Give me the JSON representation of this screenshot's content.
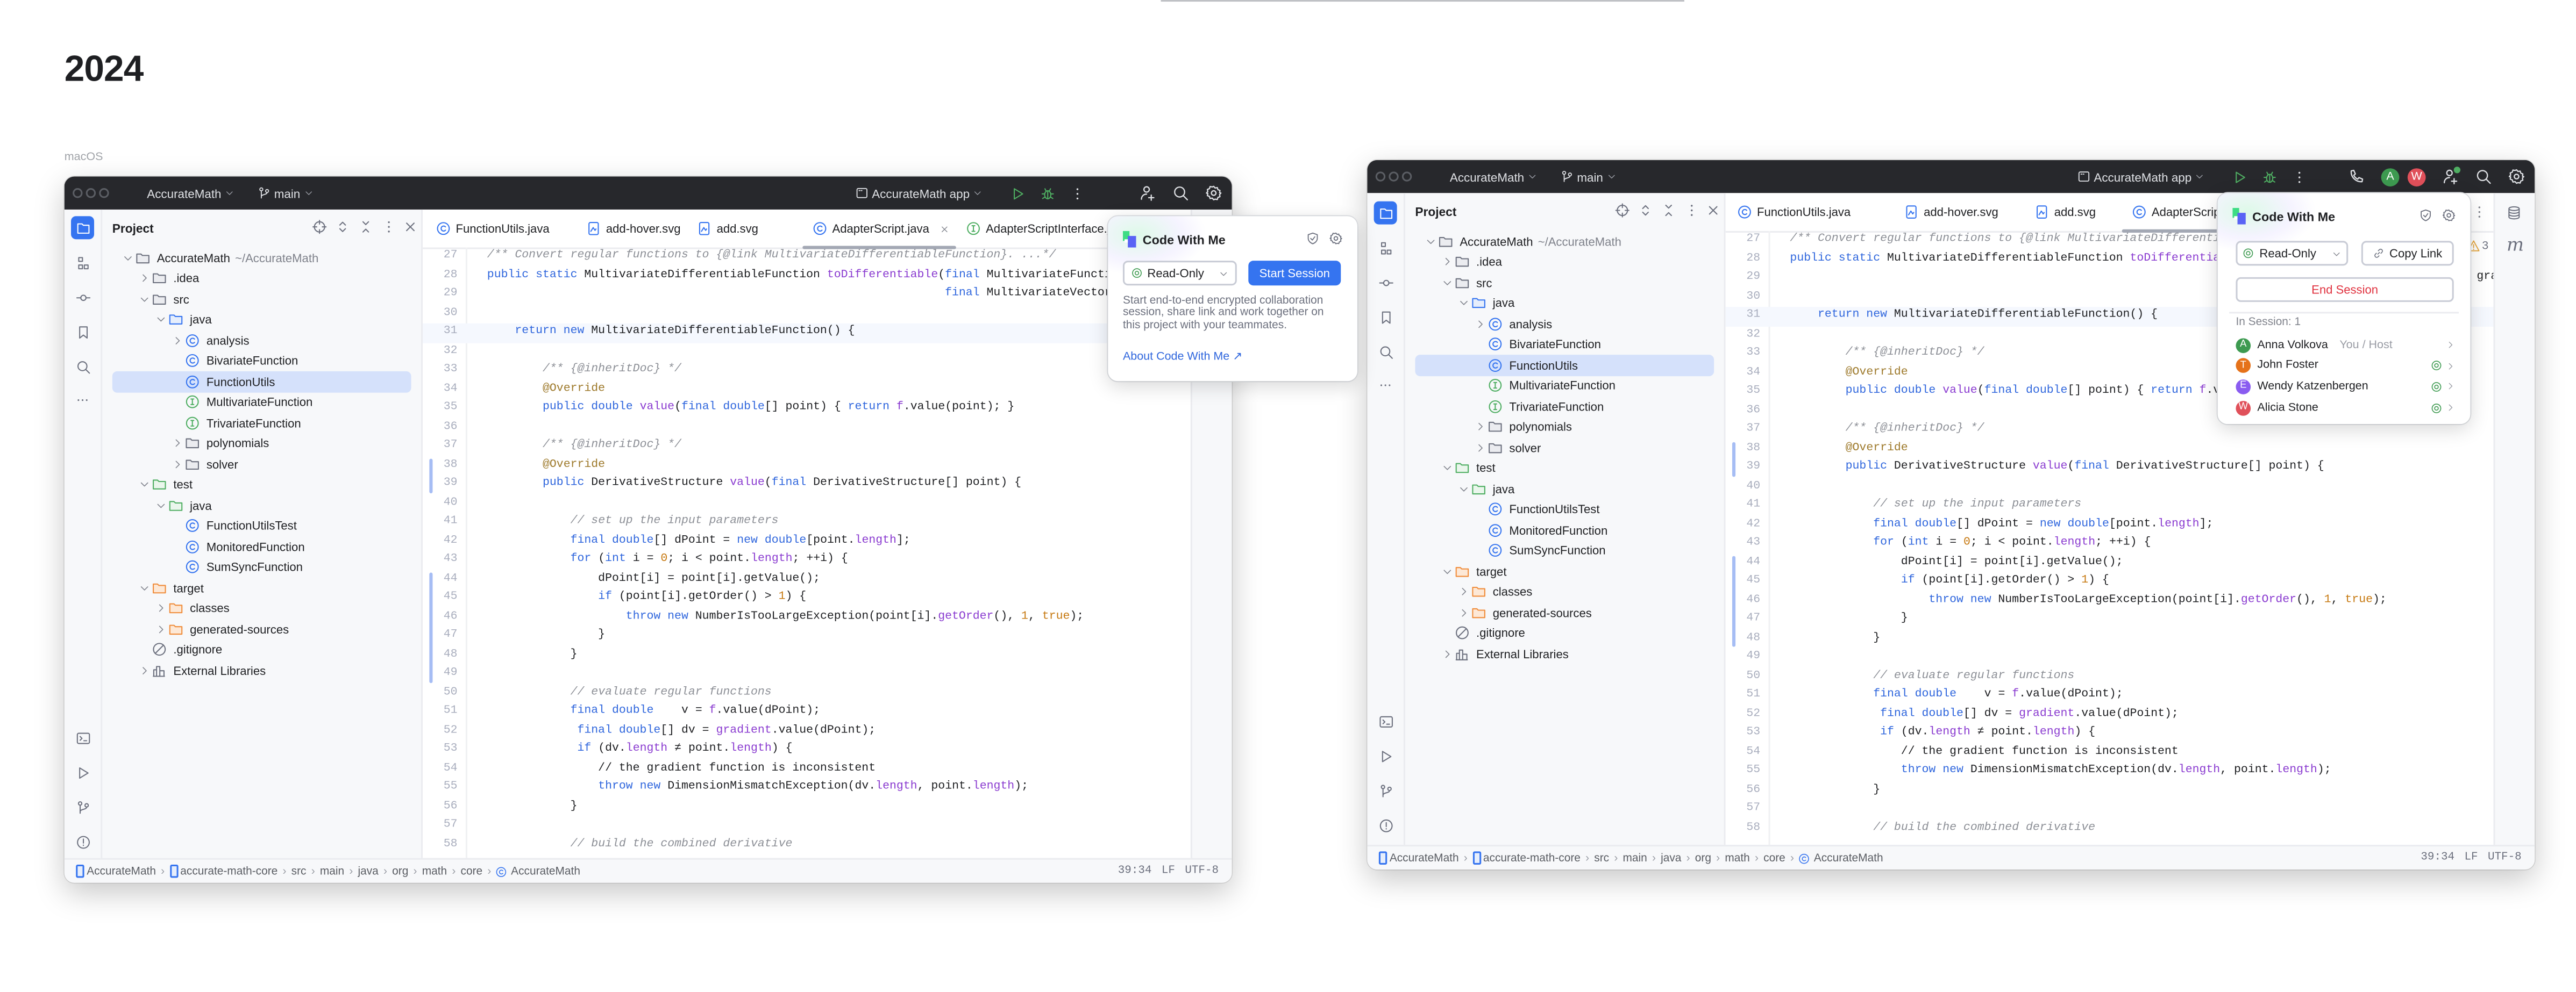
{
  "page": {
    "heading": "2024",
    "platform_label": "macOS"
  },
  "colors": {
    "accent": "#3574f0",
    "titlebar": "#27282c",
    "selection": "#d5e1fb",
    "run_green": "#4fae62",
    "danger": "#e0323f"
  },
  "code_lines": [
    {
      "n": "27",
      "t": [
        [
          "c",
          "/** Convert regular functions to {@link MultivariateDifferentiableFunction}. ...*/"
        ]
      ]
    },
    {
      "n": "28",
      "t": [
        [
          "k",
          "public static "
        ],
        [
          "t",
          "MultivariateDifferentiableFunction "
        ],
        [
          "m",
          "toDifferentiable"
        ],
        [
          "t",
          "("
        ],
        [
          "k",
          "final "
        ],
        [
          "t",
          "MultivariateFunction f,"
        ]
      ]
    },
    {
      "n": "29",
      "t": [
        [
          "t",
          "                                                                  "
        ],
        [
          "k",
          "final "
        ],
        [
          "t",
          "MultivariateVectorFunction gradient) {"
        ]
      ]
    },
    {
      "n": "30",
      "t": []
    },
    {
      "n": "31",
      "t": [
        [
          "k",
          "    return new "
        ],
        [
          "t",
          "MultivariateDifferentiableFunction() {"
        ]
      ]
    },
    {
      "n": "32",
      "t": []
    },
    {
      "n": "33",
      "t": [
        [
          "t",
          "        "
        ],
        [
          "c",
          "/** {@inheritDoc} */"
        ]
      ]
    },
    {
      "n": "34",
      "t": [
        [
          "t",
          "        "
        ],
        [
          "a",
          "@Override"
        ]
      ]
    },
    {
      "n": "35",
      "t": [
        [
          "t",
          "        "
        ],
        [
          "k",
          "public double "
        ],
        [
          "m",
          "value"
        ],
        [
          "t",
          "("
        ],
        [
          "k",
          "final double"
        ],
        [
          "t",
          "[] point) { "
        ],
        [
          "k",
          "return "
        ],
        [
          "f",
          "f"
        ],
        [
          "t",
          ".value(point); }"
        ]
      ]
    },
    {
      "n": "36",
      "t": []
    },
    {
      "n": "37",
      "t": [
        [
          "t",
          "        "
        ],
        [
          "c",
          "/** {@inheritDoc} */"
        ]
      ]
    },
    {
      "n": "38",
      "t": [
        [
          "t",
          "        "
        ],
        [
          "a",
          "@Override"
        ]
      ]
    },
    {
      "n": "39",
      "t": [
        [
          "t",
          "        "
        ],
        [
          "k",
          "public "
        ],
        [
          "t",
          "DerivativeStructure "
        ],
        [
          "m",
          "value"
        ],
        [
          "t",
          "("
        ],
        [
          "k",
          "final "
        ],
        [
          "t",
          "DerivativeStructure[] point) {"
        ]
      ]
    },
    {
      "n": "40",
      "t": []
    },
    {
      "n": "41",
      "t": [
        [
          "t",
          "            "
        ],
        [
          "c",
          "// set up the input parameters"
        ]
      ]
    },
    {
      "n": "42",
      "t": [
        [
          "t",
          "            "
        ],
        [
          "k",
          "final double"
        ],
        [
          "t",
          "[] dPoint = "
        ],
        [
          "k",
          "new double"
        ],
        [
          "t",
          "[point."
        ],
        [
          "f",
          "length"
        ],
        [
          "t",
          "];"
        ]
      ]
    },
    {
      "n": "43",
      "t": [
        [
          "t",
          "            "
        ],
        [
          "k",
          "for "
        ],
        [
          "t",
          "("
        ],
        [
          "k",
          "int "
        ],
        [
          "t",
          "i = "
        ],
        [
          "n",
          "0"
        ],
        [
          "t",
          "; i < point."
        ],
        [
          "f",
          "length"
        ],
        [
          "t",
          "; ++i) {"
        ]
      ]
    },
    {
      "n": "44",
      "t": [
        [
          "t",
          "                dPoint[i] = point[i].getValue();"
        ]
      ]
    },
    {
      "n": "45",
      "t": [
        [
          "t",
          "                "
        ],
        [
          "k",
          "if "
        ],
        [
          "t",
          "(point[i].getOrder() > "
        ],
        [
          "n",
          "1"
        ],
        [
          "t",
          ") {"
        ]
      ]
    },
    {
      "n": "46",
      "t": [
        [
          "t",
          "                    "
        ],
        [
          "k",
          "throw new "
        ],
        [
          "t",
          "NumberIsTooLargeException(point[i]."
        ],
        [
          "m",
          "getOrder"
        ],
        [
          "t",
          "(), "
        ],
        [
          "n",
          "1"
        ],
        [
          "t",
          ", "
        ],
        [
          "n",
          "true"
        ],
        [
          "t",
          ");"
        ]
      ]
    },
    {
      "n": "47",
      "t": [
        [
          "t",
          "                }"
        ]
      ]
    },
    {
      "n": "48",
      "t": [
        [
          "t",
          "            }"
        ]
      ]
    },
    {
      "n": "49",
      "t": []
    },
    {
      "n": "50",
      "t": [
        [
          "t",
          "            "
        ],
        [
          "c",
          "// evaluate regular functions"
        ]
      ]
    },
    {
      "n": "51",
      "t": [
        [
          "t",
          "            "
        ],
        [
          "k",
          "final double"
        ],
        [
          "t",
          "    v = "
        ],
        [
          "f",
          "f"
        ],
        [
          "t",
          ".value(dPoint);"
        ]
      ]
    },
    {
      "n": "52",
      "t": [
        [
          "t",
          "             "
        ],
        [
          "k",
          "final double"
        ],
        [
          "t",
          "[] dv = "
        ],
        [
          "f",
          "gradient"
        ],
        [
          "t",
          ".value(dPoint);"
        ]
      ]
    },
    {
      "n": "53",
      "t": [
        [
          "t",
          "             "
        ],
        [
          "k",
          "if "
        ],
        [
          "t",
          "(dv."
        ],
        [
          "f",
          "length"
        ],
        [
          "t",
          " ≠ point."
        ],
        [
          "f",
          "length"
        ],
        [
          "t",
          ") {"
        ]
      ]
    },
    {
      "n": "54",
      "t": [
        [
          "t",
          "                // the gradient function is inconsistent"
        ]
      ]
    },
    {
      "n": "55",
      "t": [
        [
          "t",
          "                "
        ],
        [
          "k",
          "throw new "
        ],
        [
          "t",
          "DimensionMismatchException(dv."
        ],
        [
          "f",
          "length"
        ],
        [
          "t",
          ", point."
        ],
        [
          "f",
          "length"
        ],
        [
          "t",
          ");"
        ]
      ]
    },
    {
      "n": "56",
      "t": [
        [
          "t",
          "            }"
        ]
      ]
    },
    {
      "n": "57",
      "t": []
    },
    {
      "n": "58",
      "t": [
        [
          "t",
          "            "
        ],
        [
          "c",
          "// build the combined derivative"
        ]
      ]
    }
  ],
  "windows": [
    {
      "project": "AccurateMath",
      "branch": "main",
      "run_config": "AccurateMath app",
      "titlebar_actions": [
        "add-user",
        "search",
        "gear"
      ],
      "panel_title": "Project",
      "tree": [
        {
          "label": "AccurateMath",
          "hint": "~/AccurateMath",
          "icon": "folder",
          "level": 0,
          "chevron": "down"
        },
        {
          "label": ".idea",
          "icon": "folder",
          "level": 1,
          "chevron": "right"
        },
        {
          "label": "src",
          "icon": "folder",
          "level": 1,
          "chevron": "down"
        },
        {
          "label": "java",
          "icon": "folder-source",
          "level": 2,
          "chevron": "down"
        },
        {
          "label": "analysis",
          "icon": "class",
          "level": 3,
          "chevron": "right"
        },
        {
          "label": "BivariateFunction",
          "icon": "class",
          "level": 3
        },
        {
          "label": "FunctionUtils",
          "icon": "class",
          "level": 3,
          "selected": true
        },
        {
          "label": "MultivariateFunction",
          "icon": "interface",
          "level": 3
        },
        {
          "label": "TrivariateFunction",
          "icon": "interface",
          "level": 3
        },
        {
          "label": "polynomials",
          "icon": "folder",
          "level": 3,
          "chevron": "right"
        },
        {
          "label": "solver",
          "icon": "folder",
          "level": 3,
          "chevron": "right"
        },
        {
          "label": "test",
          "icon": "folder-test",
          "level": 1,
          "chevron": "down"
        },
        {
          "label": "java",
          "icon": "folder-test",
          "level": 2,
          "chevron": "down"
        },
        {
          "label": "FunctionUtilsTest",
          "icon": "class",
          "level": 3
        },
        {
          "label": "MonitoredFunction",
          "icon": "class",
          "level": 3
        },
        {
          "label": "SumSyncFunction",
          "icon": "class",
          "level": 3
        },
        {
          "label": "target",
          "icon": "folder-excluded",
          "level": 1,
          "chevron": "down"
        },
        {
          "label": "classes",
          "icon": "folder-excluded",
          "level": 2,
          "chevron": "right"
        },
        {
          "label": "generated-sources",
          "icon": "folder-excluded",
          "level": 2,
          "chevron": "right"
        },
        {
          "label": ".gitignore",
          "icon": "ignore",
          "level": 1
        },
        {
          "label": "External Libraries",
          "icon": "libraries",
          "level": 1,
          "chevron": "right"
        }
      ],
      "tabs": [
        {
          "label": "FunctionUtils.java",
          "icon": "class"
        },
        {
          "label": "add-hover.svg",
          "icon": "svg"
        },
        {
          "label": "add.svg",
          "icon": "svg"
        },
        {
          "label": "AdapterScript.java",
          "icon": "class",
          "active": true,
          "closable": true
        },
        {
          "label": "AdapterScriptInterface.java",
          "icon": "interface"
        }
      ],
      "caret_line": "31",
      "changed_ranges": [
        [
          "38",
          "39"
        ],
        [
          "44",
          "49"
        ]
      ],
      "breadcrumb": [
        "AccurateMath",
        "accurate-math-core",
        "src",
        "main",
        "java",
        "org",
        "math",
        "core",
        "AccurateMath"
      ],
      "status": {
        "position": "39:34",
        "line_separator": "LF",
        "encoding": "UTF-8"
      },
      "popup": {
        "title": "Code With Me",
        "mode": "Read-Only",
        "primary_button": "Start Session",
        "description": "Start end-to-end encrypted collaboration session, share link and work together on this project with your teammates.",
        "link": "About Code With Me ↗"
      }
    },
    {
      "project": "AccurateMath",
      "branch": "main",
      "run_config": "AccurateMath app",
      "titlebar_actions": [
        "phone",
        "avatars",
        "add-user",
        "search",
        "gear"
      ],
      "titlebar_avatars": [
        {
          "initial": "A",
          "color": "#3d9a50"
        },
        {
          "initial": "W",
          "color": "#e0505a"
        }
      ],
      "panel_title": "Project",
      "tree": [
        {
          "label": "AccurateMath",
          "hint": "~/AccurateMath",
          "icon": "folder",
          "level": 0,
          "chevron": "down"
        },
        {
          "label": ".idea",
          "icon": "folder",
          "level": 1,
          "chevron": "right"
        },
        {
          "label": "src",
          "icon": "folder",
          "level": 1,
          "chevron": "down"
        },
        {
          "label": "java",
          "icon": "folder-source",
          "level": 2,
          "chevron": "down"
        },
        {
          "label": "analysis",
          "icon": "class",
          "level": 3,
          "chevron": "right"
        },
        {
          "label": "BivariateFunction",
          "icon": "class",
          "level": 3
        },
        {
          "label": "FunctionUtils",
          "icon": "class",
          "level": 3,
          "selected": true
        },
        {
          "label": "MultivariateFunction",
          "icon": "interface",
          "level": 3
        },
        {
          "label": "TrivariateFunction",
          "icon": "interface",
          "level": 3
        },
        {
          "label": "polynomials",
          "icon": "folder",
          "level": 3,
          "chevron": "right"
        },
        {
          "label": "solver",
          "icon": "folder",
          "level": 3,
          "chevron": "right"
        },
        {
          "label": "test",
          "icon": "folder-test",
          "level": 1,
          "chevron": "down"
        },
        {
          "label": "java",
          "icon": "folder-test",
          "level": 2,
          "chevron": "down"
        },
        {
          "label": "FunctionUtilsTest",
          "icon": "class",
          "level": 3
        },
        {
          "label": "MonitoredFunction",
          "icon": "class",
          "level": 3
        },
        {
          "label": "SumSyncFunction",
          "icon": "class",
          "level": 3
        },
        {
          "label": "target",
          "icon": "folder-excluded",
          "level": 1,
          "chevron": "down"
        },
        {
          "label": "classes",
          "icon": "folder-excluded",
          "level": 2,
          "chevron": "right"
        },
        {
          "label": "generated-sources",
          "icon": "folder-excluded",
          "level": 2,
          "chevron": "right"
        },
        {
          "label": ".gitignore",
          "icon": "ignore",
          "level": 1
        },
        {
          "label": "External Libraries",
          "icon": "libraries",
          "level": 1,
          "chevron": "right"
        }
      ],
      "tabs": [
        {
          "label": "FunctionUtils.java",
          "icon": "class"
        },
        {
          "label": "add-hover.svg",
          "icon": "svg"
        },
        {
          "label": "add.svg",
          "icon": "svg"
        },
        {
          "label": "AdapterScript.java",
          "icon": "class",
          "active": true
        }
      ],
      "inspection_warnings": "3",
      "caret_line": "31",
      "changed_ranges": [
        [
          "38",
          "39"
        ],
        [
          "44",
          "48"
        ]
      ],
      "breadcrumb": [
        "AccurateMath",
        "accurate-math-core",
        "src",
        "main",
        "java",
        "org",
        "math",
        "core",
        "AccurateMath"
      ],
      "status": {
        "position": "39:34",
        "line_separator": "LF",
        "encoding": "UTF-8"
      },
      "popup": {
        "title": "Code With Me",
        "mode": "Read-Only",
        "copy_link": "Copy Link",
        "end_session": "End Session",
        "in_session_label": "In Session: 1",
        "participants": [
          {
            "initial": "A",
            "name": "Anna Volkova",
            "role": "You / Host",
            "color": "#3d9a50"
          },
          {
            "initial": "T",
            "name": "John Foster",
            "color": "#e5721a",
            "read_only": true
          },
          {
            "initial": "E",
            "name": "Wendy Katzenbergen",
            "color": "#8a5cf0",
            "read_only": true
          },
          {
            "initial": "W",
            "name": "Alicia Stone",
            "color": "#e0505a",
            "read_only": true
          }
        ]
      }
    }
  ]
}
